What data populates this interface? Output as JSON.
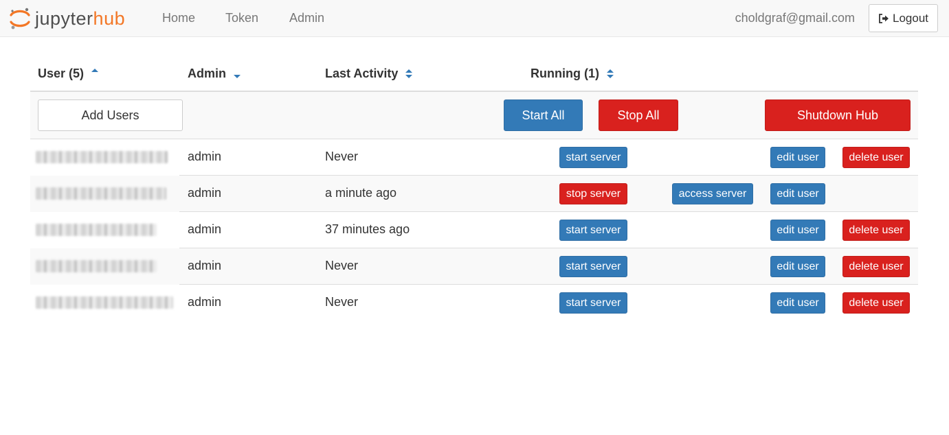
{
  "navbar": {
    "logo_text_a": "jupyter",
    "logo_text_b": "hub",
    "links": [
      "Home",
      "Token",
      "Admin"
    ],
    "user_email": "choldgraf@gmail.com",
    "logout_label": "Logout"
  },
  "table": {
    "headers": {
      "user": "User (5)",
      "admin": "Admin",
      "last_activity": "Last Activity",
      "running": "Running (1)"
    },
    "sort_state": {
      "user": "ascending",
      "admin": "descending",
      "last_activity": "unsorted",
      "running": "unsorted"
    },
    "tools": {
      "add_users": "Add Users",
      "start_all": "Start All",
      "stop_all": "Stop All",
      "shutdown_hub": "Shutdown Hub"
    },
    "rows": [
      {
        "admin": "admin",
        "last_activity": "Never",
        "server_button": "start server",
        "access_button": "",
        "edit_button": "edit user",
        "delete_button": "delete user"
      },
      {
        "admin": "admin",
        "last_activity": "a minute ago",
        "server_button": "stop server",
        "access_button": "access server",
        "edit_button": "edit user",
        "delete_button": ""
      },
      {
        "admin": "admin",
        "last_activity": "37 minutes ago",
        "server_button": "start server",
        "access_button": "",
        "edit_button": "edit user",
        "delete_button": "delete user"
      },
      {
        "admin": "admin",
        "last_activity": "Never",
        "server_button": "start server",
        "access_button": "",
        "edit_button": "edit user",
        "delete_button": "delete user"
      },
      {
        "admin": "admin",
        "last_activity": "Never",
        "server_button": "start server",
        "access_button": "",
        "edit_button": "edit user",
        "delete_button": "delete user"
      }
    ]
  },
  "colors": {
    "brand_orange": "#f37726",
    "primary": "#337ab7",
    "danger": "#d9211e"
  },
  "icons": {
    "logo": "jupyter-logo-icon",
    "logout": "sign-out-icon",
    "sort_asc": "sort-asc-icon",
    "sort_desc": "sort-desc-icon",
    "sort_both": "sort-icon"
  }
}
